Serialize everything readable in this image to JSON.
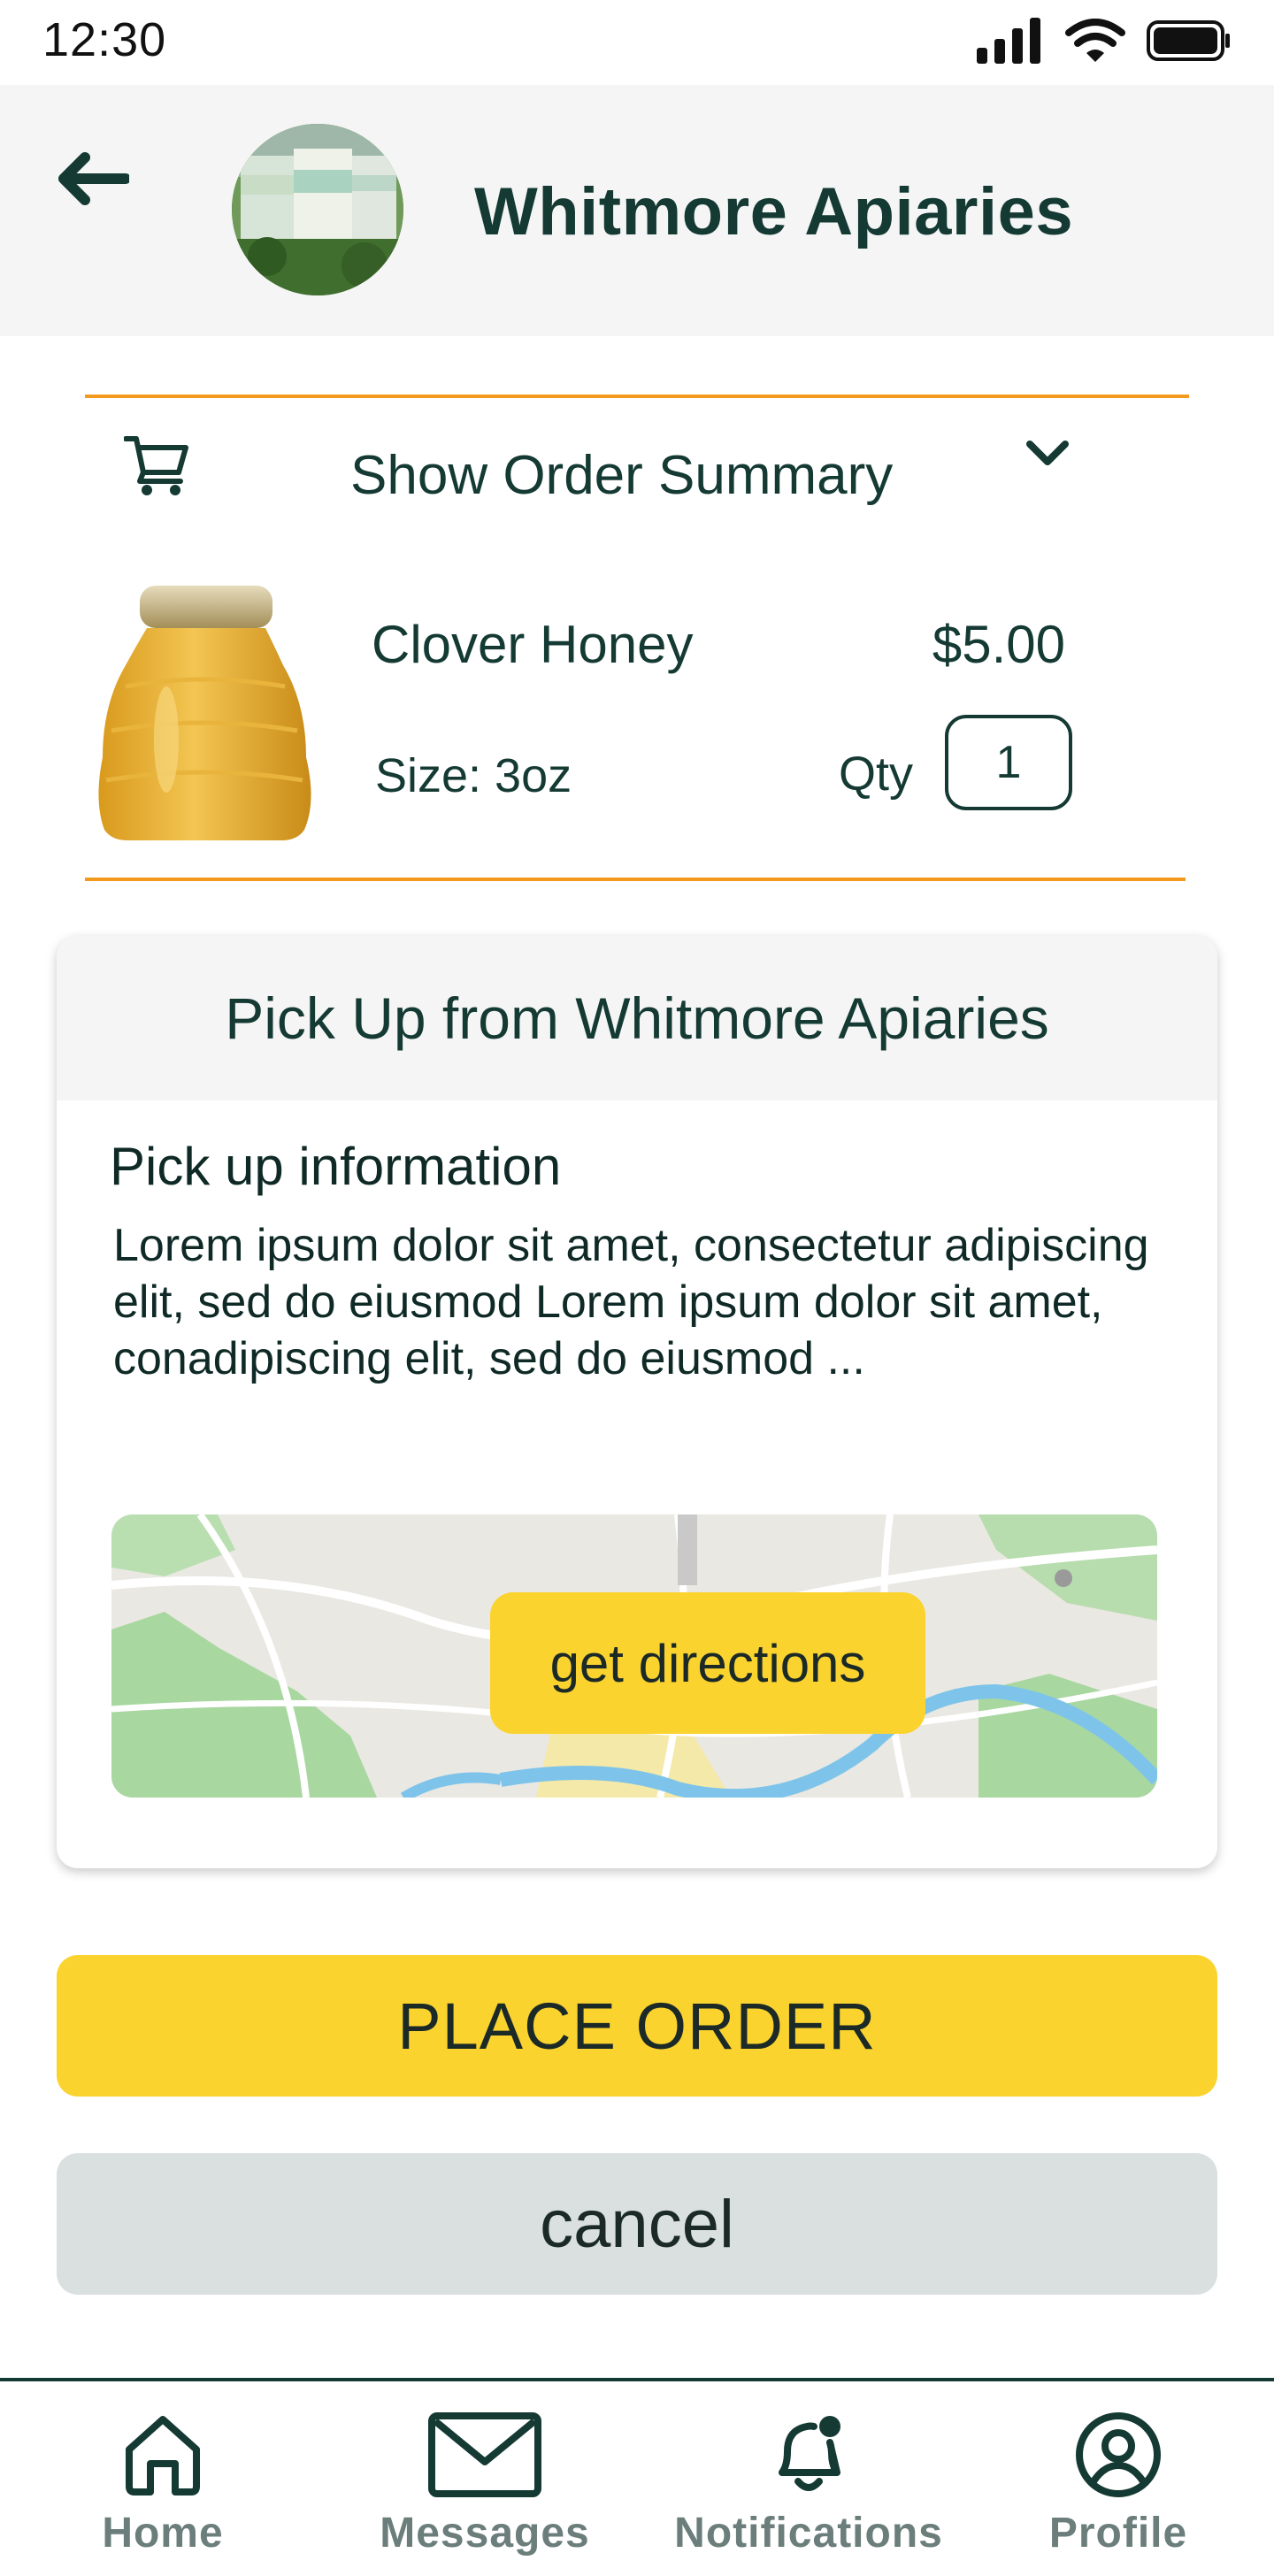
{
  "status_bar": {
    "time": "12:30",
    "icons": [
      "signal-icon",
      "wifi-icon",
      "battery-icon"
    ]
  },
  "header": {
    "back_icon": "arrow-left-icon",
    "store_name": "Whitmore Apiaries"
  },
  "order_summary": {
    "toggle_label": "Show Order Summary",
    "cart_icon": "cart-icon",
    "chevron_icon": "chevron-down-icon",
    "item": {
      "name": "Clover Honey",
      "price": "$5.00",
      "size": "Size: 3oz",
      "qty_label": "Qty",
      "qty_value": "1"
    }
  },
  "pickup": {
    "title": "Pick Up from Whitmore Apiaries",
    "info_title": "Pick up information",
    "info_text": "Lorem ipsum dolor sit amet, consectetur adipiscing elit, sed do eiusmod Lorem ipsum dolor sit amet, conadipiscing elit, sed do eiusmod ...",
    "directions_label": "get directions"
  },
  "actions": {
    "place_order_label": "PLACE ORDER",
    "cancel_label": "cancel"
  },
  "bottom_nav": {
    "items": [
      {
        "label": "Home",
        "icon": "home-icon"
      },
      {
        "label": "Messages",
        "icon": "mail-icon"
      },
      {
        "label": "Notifications",
        "icon": "bell-icon"
      },
      {
        "label": "Profile",
        "icon": "user-icon"
      }
    ]
  },
  "colors": {
    "accent_yellow": "#fbd32f",
    "divider_orange": "#f39a1e",
    "text_dark": "#143a33",
    "cancel_gray": "#d9e0df",
    "nav_label_gray": "#6b7e7b"
  }
}
